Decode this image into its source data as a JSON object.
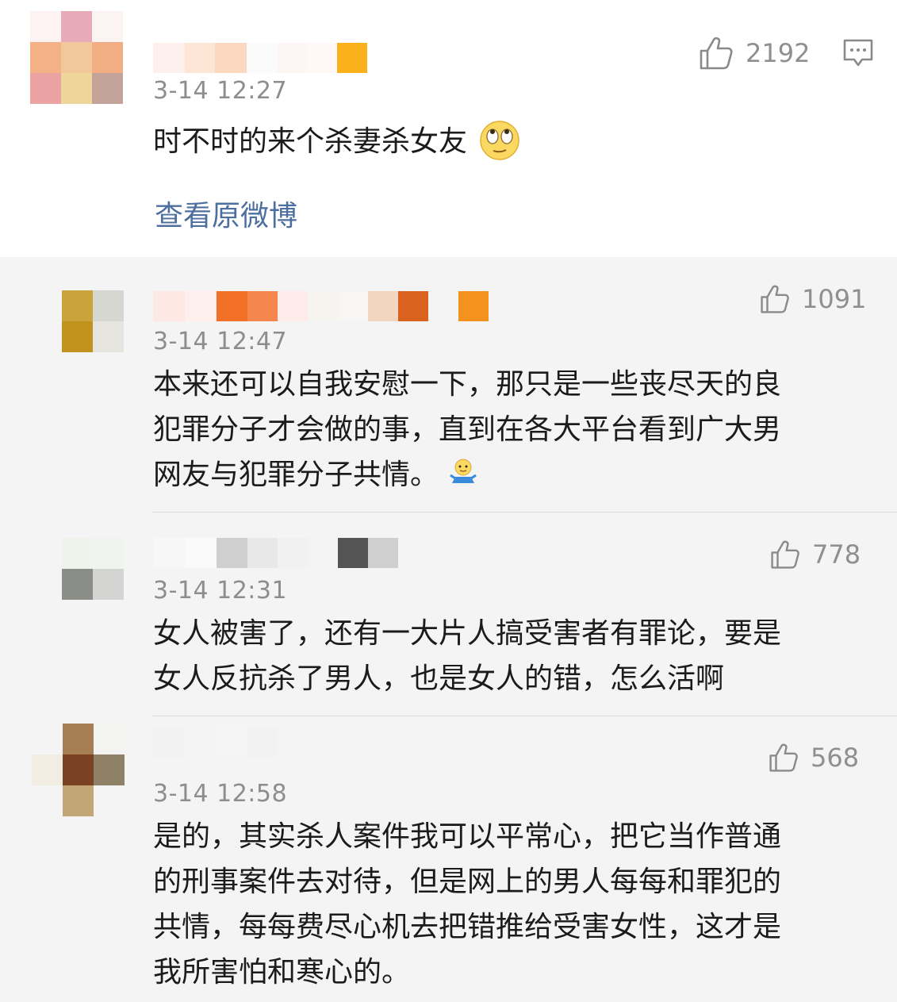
{
  "main": {
    "time": "3-14 12:27",
    "text": "时不时的来个杀妻杀女友",
    "likes": "2192",
    "view_original": "查看原微博",
    "emoji_icon": "rolling-eyes-icon",
    "reply_icon": "comment-icon"
  },
  "replies": [
    {
      "time": "3-14 12:47",
      "likes": "1091",
      "lines": [
        "本来还可以自我安慰一下，那只是一些丧尽天的良",
        "犯罪分子才会做的事，直到在各大平台看到广大男",
        "网友与犯罪分子共情。"
      ],
      "emoji_icon": "shrug-icon"
    },
    {
      "time": "3-14 12:31",
      "likes": "778",
      "lines": [
        "女人被害了，还有一大片人搞受害者有罪论，要是",
        "女人反抗杀了男人，也是女人的错，怎么活啊"
      ]
    },
    {
      "time": "3-14 12:58",
      "likes": "568",
      "lines": [
        "是的，其实杀人案件我可以平常心，把它当作普通",
        "的刑事案件去对待，但是网上的男人每每和罪犯的",
        "共情，每每费尽心机去把错推给受害女性，这才是",
        "我所害怕和寒心的。"
      ]
    }
  ],
  "colors": {
    "link": "#4d6fa0",
    "meta": "#8d8d8d",
    "text": "#1b1b1b",
    "reply_bg": "#f4f4f4"
  }
}
